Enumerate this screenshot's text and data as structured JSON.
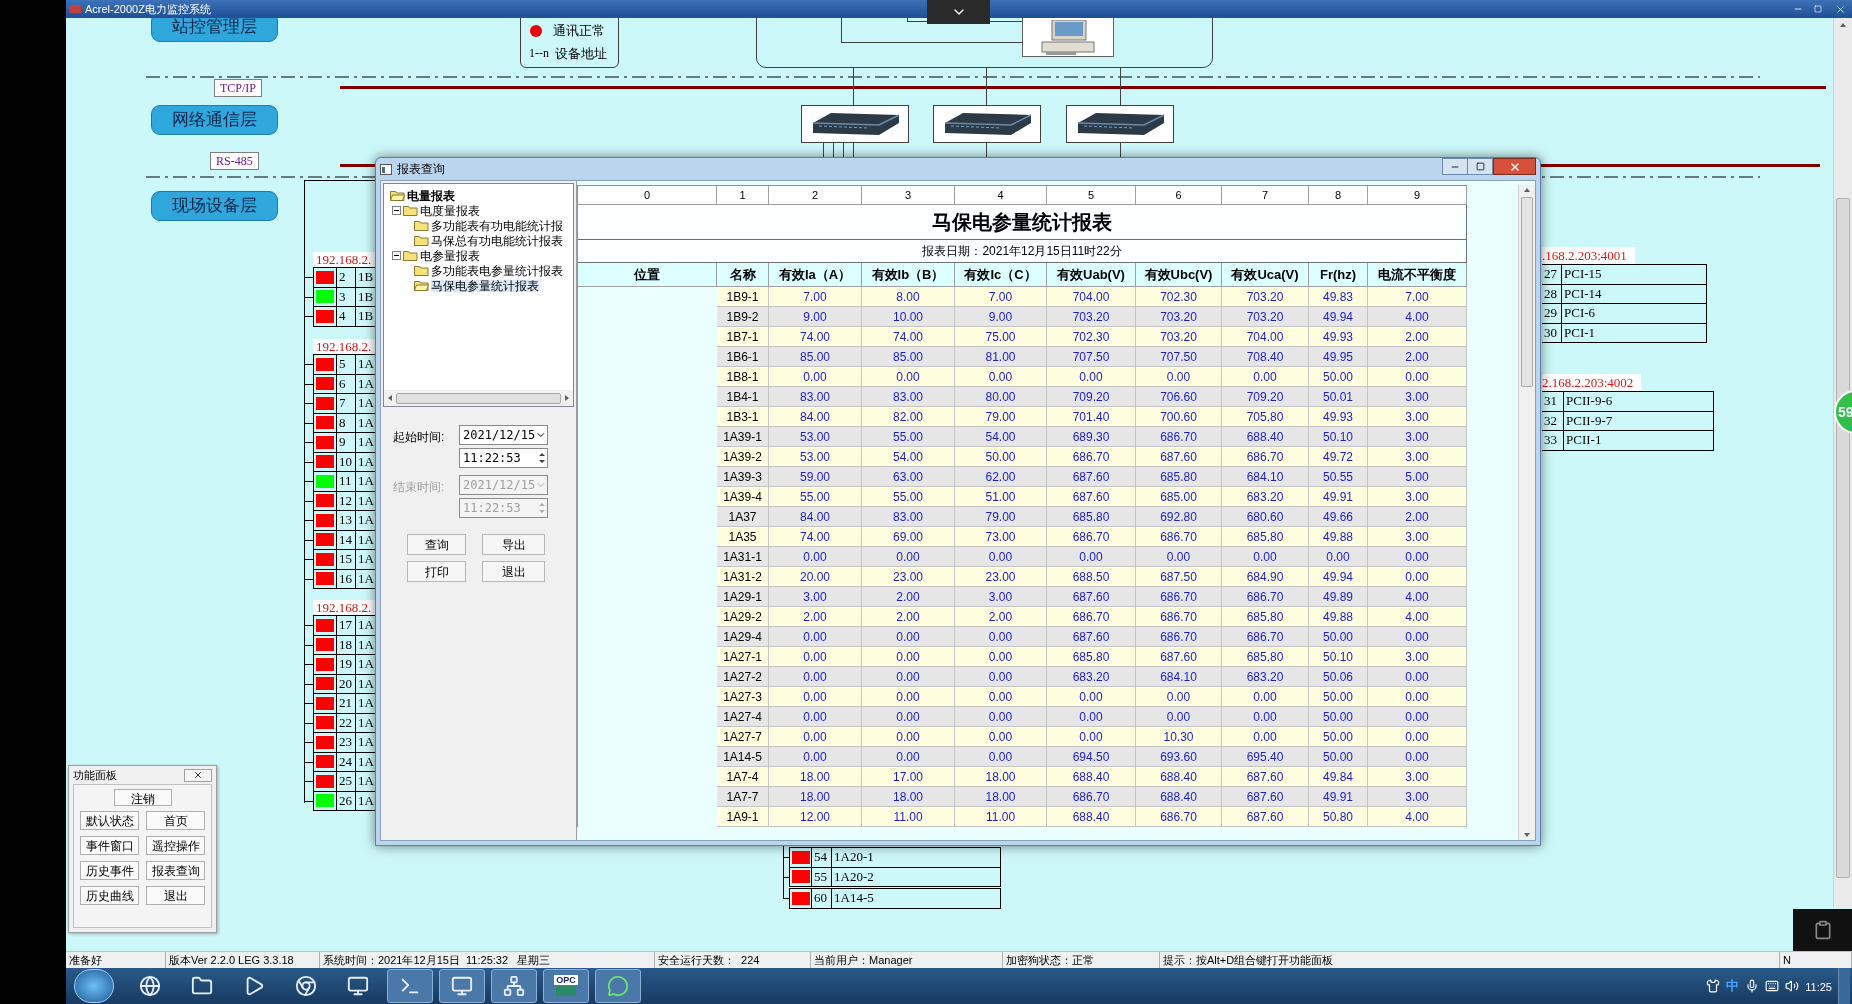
{
  "window": {
    "title": "Acrel-2000Z电力监控系统"
  },
  "layers": [
    {
      "label": "站控管理层"
    },
    {
      "label": "网络通信层"
    },
    {
      "label": "现场设备层"
    }
  ],
  "bus_labels": [
    "TCP/IP",
    "RS-485"
  ],
  "legend": {
    "status_text": "通讯正常",
    "address_symbol": "1--n",
    "address_text": "设备地址"
  },
  "device_groups": [
    {
      "address": "192.168.2.",
      "devices": [
        {
          "number": "2",
          "name": "1B",
          "color": "#ff0000"
        },
        {
          "number": "3",
          "name": "1B",
          "color": "#00ff00"
        },
        {
          "number": "4",
          "name": "1B",
          "color": "#ff0000"
        }
      ]
    },
    {
      "address": "192.168.2.",
      "devices": [
        {
          "number": "5",
          "name": "1A",
          "color": "#ff0000"
        },
        {
          "number": "6",
          "name": "1A",
          "color": "#ff0000"
        },
        {
          "number": "7",
          "name": "1A",
          "color": "#ff0000"
        },
        {
          "number": "8",
          "name": "1A",
          "color": "#ff0000"
        },
        {
          "number": "9",
          "name": "1A",
          "color": "#ff0000"
        },
        {
          "number": "10",
          "name": "1A",
          "color": "#ff0000"
        },
        {
          "number": "11",
          "name": "1A",
          "color": "#00ff00"
        },
        {
          "number": "12",
          "name": "1A",
          "color": "#ff0000"
        },
        {
          "number": "13",
          "name": "1A",
          "color": "#ff0000"
        },
        {
          "number": "14",
          "name": "1A",
          "color": "#ff0000"
        },
        {
          "number": "15",
          "name": "1A",
          "color": "#ff0000"
        },
        {
          "number": "16",
          "name": "1A",
          "color": "#ff0000"
        }
      ]
    },
    {
      "address": "192.168.2.",
      "devices": [
        {
          "number": "17",
          "name": "1A",
          "color": "#ff0000"
        },
        {
          "number": "18",
          "name": "1A",
          "color": "#ff0000"
        },
        {
          "number": "19",
          "name": "1A",
          "color": "#ff0000"
        },
        {
          "number": "20",
          "name": "1A",
          "color": "#ff0000"
        },
        {
          "number": "21",
          "name": "1A",
          "color": "#ff0000"
        },
        {
          "number": "22",
          "name": "1A",
          "color": "#ff0000"
        },
        {
          "number": "23",
          "name": "1A",
          "color": "#ff0000"
        },
        {
          "number": "24",
          "name": "1A",
          "color": "#ff0000"
        },
        {
          "number": "25",
          "name": "1A",
          "color": "#ff0000"
        },
        {
          "number": "26",
          "name": "1A",
          "color": "#00ff00"
        }
      ]
    }
  ],
  "right_device_groups": [
    {
      "address": ".168.2.203:4001",
      "devices": [
        {
          "number": "27",
          "name": "PCI-15"
        },
        {
          "number": "28",
          "name": "PCI-14"
        },
        {
          "number": "29",
          "name": "PCI-6"
        },
        {
          "number": "30",
          "name": "PCI-1"
        }
      ]
    },
    {
      "address": "2.168.2.203:4002",
      "devices": [
        {
          "number": "31",
          "name": "PCII-9-6"
        },
        {
          "number": "32",
          "name": "PCII-9-7"
        },
        {
          "number": "33",
          "name": "PCII-1"
        }
      ]
    }
  ],
  "report_dialog": {
    "title": "报表查询",
    "tree": [
      {
        "label": "电量报表",
        "selected": false,
        "children": [
          {
            "label": "电度量报表",
            "expanded": true,
            "selected": false,
            "children": [
              {
                "label": "多功能表有功电能统计报",
                "selected": false
              },
              {
                "label": "马保总有功电能统计报表",
                "selected": false
              }
            ]
          },
          {
            "label": "电参量报表",
            "expanded": true,
            "selected": false,
            "children": [
              {
                "label": "多功能表电参量统计报表",
                "selected": false
              },
              {
                "label": "马保电参量统计报表",
                "selected": true
              }
            ]
          }
        ]
      }
    ],
    "start_time": {
      "label": "起始时间:",
      "date": "2021/12/15",
      "time": "11:22:53",
      "disabled": false
    },
    "end_time": {
      "label": "结束时间:",
      "date": "2021/12/15",
      "time": "11:22:53",
      "disabled": true
    },
    "buttons": [
      "查询",
      "导出",
      "打印",
      "退出"
    ],
    "grid": {
      "column_numbers": [
        "0",
        "1",
        "2",
        "3",
        "4",
        "5",
        "6",
        "7",
        "8",
        "9"
      ],
      "title": "马保电参量统计报表",
      "date": "报表日期：2021年12月15日11时22分",
      "headers": [
        "位置",
        "名称",
        "有效Ia（A）",
        "有效Ib（B）",
        "有效Ic（C）",
        "有效Uab(V)",
        "有效Ubc(V)",
        "有效Uca(V)",
        "Fr(hz)",
        "电流不平衡度"
      ],
      "rows": [
        {
          "name": "1B9-1",
          "values": [
            "7.00",
            "8.00",
            "7.00",
            "704.00",
            "702.30",
            "703.20",
            "49.83",
            "7.00"
          ]
        },
        {
          "name": "1B9-2",
          "values": [
            "9.00",
            "10.00",
            "9.00",
            "703.20",
            "703.20",
            "703.20",
            "49.94",
            "4.00"
          ]
        },
        {
          "name": "1B7-1",
          "values": [
            "74.00",
            "74.00",
            "75.00",
            "702.30",
            "703.20",
            "704.00",
            "49.93",
            "2.00"
          ]
        },
        {
          "name": "1B6-1",
          "values": [
            "85.00",
            "85.00",
            "81.00",
            "707.50",
            "707.50",
            "708.40",
            "49.95",
            "2.00"
          ]
        },
        {
          "name": "1B8-1",
          "values": [
            "0.00",
            "0.00",
            "0.00",
            "0.00",
            "0.00",
            "0.00",
            "50.00",
            "0.00"
          ]
        },
        {
          "name": "1B4-1",
          "values": [
            "83.00",
            "83.00",
            "80.00",
            "709.20",
            "706.60",
            "709.20",
            "50.01",
            "3.00"
          ]
        },
        {
          "name": "1B3-1",
          "values": [
            "84.00",
            "82.00",
            "79.00",
            "701.40",
            "700.60",
            "705.80",
            "49.93",
            "3.00"
          ]
        },
        {
          "name": "1A39-1",
          "values": [
            "53.00",
            "55.00",
            "54.00",
            "689.30",
            "686.70",
            "688.40",
            "50.10",
            "3.00"
          ]
        },
        {
          "name": "1A39-2",
          "values": [
            "53.00",
            "54.00",
            "50.00",
            "686.70",
            "687.60",
            "686.70",
            "49.72",
            "3.00"
          ]
        },
        {
          "name": "1A39-3",
          "values": [
            "59.00",
            "63.00",
            "62.00",
            "687.60",
            "685.80",
            "684.10",
            "50.55",
            "5.00"
          ]
        },
        {
          "name": "1A39-4",
          "values": [
            "55.00",
            "55.00",
            "51.00",
            "687.60",
            "685.00",
            "683.20",
            "49.91",
            "3.00"
          ]
        },
        {
          "name": "1A37",
          "values": [
            "84.00",
            "83.00",
            "79.00",
            "685.80",
            "692.80",
            "680.60",
            "49.66",
            "2.00"
          ]
        },
        {
          "name": "1A35",
          "values": [
            "74.00",
            "69.00",
            "73.00",
            "686.70",
            "686.70",
            "685.80",
            "49.88",
            "3.00"
          ]
        },
        {
          "name": "1A31-1",
          "values": [
            "0.00",
            "0.00",
            "0.00",
            "0.00",
            "0.00",
            "0.00",
            "0.00",
            "0.00"
          ]
        },
        {
          "name": "1A31-2",
          "values": [
            "20.00",
            "23.00",
            "23.00",
            "688.50",
            "687.50",
            "684.90",
            "49.94",
            "0.00"
          ]
        },
        {
          "name": "1A29-1",
          "values": [
            "3.00",
            "2.00",
            "3.00",
            "687.60",
            "686.70",
            "686.70",
            "49.89",
            "4.00"
          ]
        },
        {
          "name": "1A29-2",
          "values": [
            "2.00",
            "2.00",
            "2.00",
            "686.70",
            "686.70",
            "685.80",
            "49.88",
            "4.00"
          ]
        },
        {
          "name": "1A29-4",
          "values": [
            "0.00",
            "0.00",
            "0.00",
            "687.60",
            "686.70",
            "686.70",
            "50.00",
            "0.00"
          ]
        },
        {
          "name": "1A27-1",
          "values": [
            "0.00",
            "0.00",
            "0.00",
            "685.80",
            "687.60",
            "685.80",
            "50.10",
            "3.00"
          ]
        },
        {
          "name": "1A27-2",
          "values": [
            "0.00",
            "0.00",
            "0.00",
            "683.20",
            "684.10",
            "683.20",
            "50.06",
            "0.00"
          ]
        },
        {
          "name": "1A27-3",
          "values": [
            "0.00",
            "0.00",
            "0.00",
            "0.00",
            "0.00",
            "0.00",
            "50.00",
            "0.00"
          ]
        },
        {
          "name": "1A27-4",
          "values": [
            "0.00",
            "0.00",
            "0.00",
            "0.00",
            "0.00",
            "0.00",
            "50.00",
            "0.00"
          ]
        },
        {
          "name": "1A27-7",
          "values": [
            "0.00",
            "0.00",
            "0.00",
            "0.00",
            "10.30",
            "0.00",
            "50.00",
            "0.00"
          ]
        },
        {
          "name": "1A14-5",
          "values": [
            "0.00",
            "0.00",
            "0.00",
            "694.50",
            "693.60",
            "695.40",
            "50.00",
            "0.00"
          ]
        },
        {
          "name": "1A7-4",
          "values": [
            "18.00",
            "17.00",
            "18.00",
            "688.40",
            "688.40",
            "687.60",
            "49.84",
            "3.00"
          ]
        },
        {
          "name": "1A7-7",
          "values": [
            "18.00",
            "18.00",
            "18.00",
            "686.70",
            "688.40",
            "687.60",
            "49.91",
            "3.00"
          ]
        },
        {
          "name": "1A9-1",
          "values": [
            "12.00",
            "11.00",
            "11.00",
            "688.40",
            "686.70",
            "687.60",
            "50.80",
            "4.00"
          ]
        }
      ]
    }
  },
  "bottom_devices": [
    {
      "number": "54",
      "name": "1A20-1",
      "color": "#ff0000"
    },
    {
      "number": "55",
      "name": "1A20-2",
      "color": "#ff0000"
    },
    {
      "number": "60",
      "name": "1A14-5",
      "color": "#ff0000"
    }
  ],
  "function_panel": {
    "title": "功能面板",
    "buttons": [
      "注销",
      "默认状态",
      "首页",
      "事件窗口",
      "遥控操作",
      "历史事件",
      "报表查询",
      "历史曲线",
      "退出"
    ]
  },
  "status_bar": [
    "准备好",
    "版本Ver 2.2.0 LEG 3.3.18",
    "系统时间：2021年12月15日  11:25:32   星期三",
    "安全运行天数：  224",
    "当前用户：Manager",
    "加密狗状态：正常",
    "提示：按Alt+D组合键打开功能面板",
    "N"
  ],
  "taskbar": {
    "opc_label": "OPC",
    "ime": "中",
    "clock": "11:25"
  },
  "notification_badge": {
    "count": "59"
  }
}
